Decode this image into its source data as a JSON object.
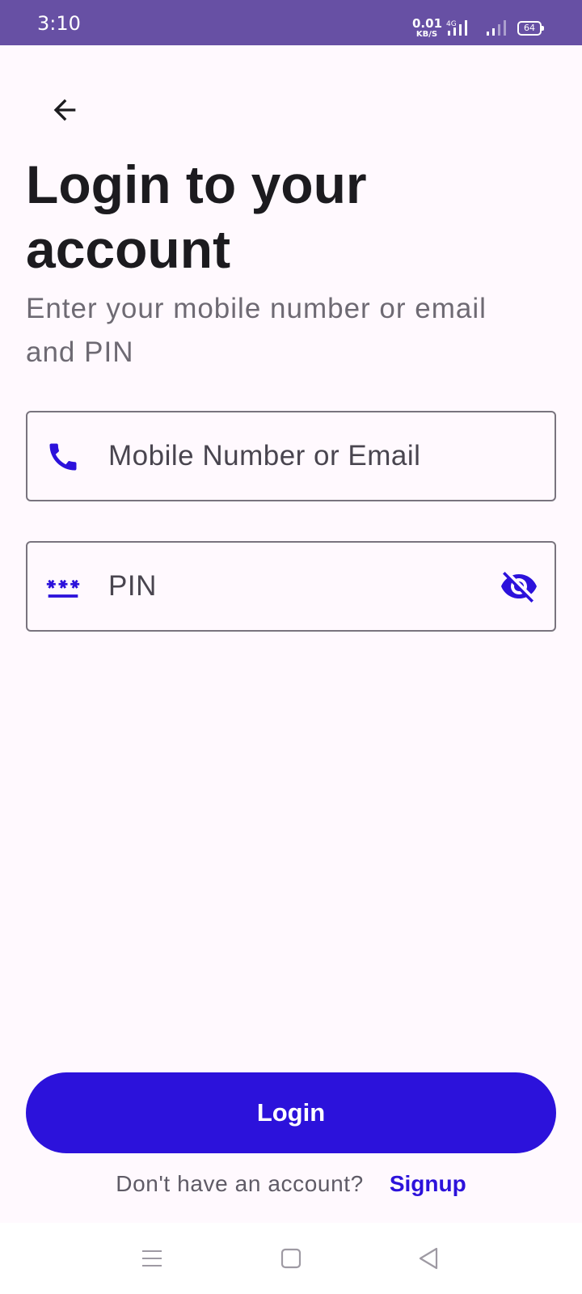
{
  "status_bar": {
    "time": "3:10",
    "net_speed_value": "0.01",
    "net_speed_unit": "KB/S",
    "network_type": "4G",
    "battery_level": "64",
    "background": "#6750A4"
  },
  "header": {
    "back_icon": "arrow-left-icon",
    "title": "Login to your account",
    "subtitle": "Enter your mobile number or email and PIN"
  },
  "form": {
    "identifier_field": {
      "placeholder": "Mobile Number or Email",
      "value": "",
      "icon": "phone-icon"
    },
    "pin_field": {
      "placeholder": "PIN",
      "value": "",
      "icon": "password-icon",
      "toggle_icon": "visibility-off-icon"
    }
  },
  "actions": {
    "login_label": "Login",
    "signup_prompt": "Don't have an account?",
    "signup_label": "Signup"
  },
  "nav_bar": {
    "menu_icon": "menu-icon",
    "home_icon": "home-square-icon",
    "back_icon": "back-triangle-icon"
  },
  "colors": {
    "primary": "#2C12DB",
    "background": "#FFF9FE",
    "status_bar": "#6750A4",
    "text_primary": "#1C1B1F",
    "text_secondary": "#6E6A73",
    "outline": "#79747E"
  }
}
